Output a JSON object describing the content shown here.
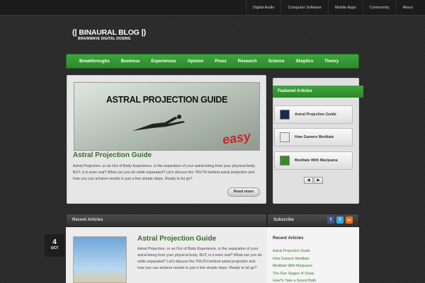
{
  "topnav": [
    "Digital Audio",
    "Computer Software",
    "Mobile Apps",
    "Community",
    "About"
  ],
  "logo": {
    "title": "BINAURAL BLOG",
    "subtitle": "BRAINWAVE DIGITAL DOSING"
  },
  "mainnav": [
    "Breakthroughs",
    "Business",
    "Experiences",
    "Opinion",
    "Press",
    "Research",
    "Science",
    "Skeptics",
    "Theory"
  ],
  "feature": {
    "image_title": "ASTRAL PROJECTION GUIDE",
    "image_tag": "easy",
    "title": "Astral Projection Guide",
    "excerpt": "Astral Projection, or an Out of Body Experience, is the separation of your astral being from your physical body. BUT, is it even real? What can you do while separated? Let's discuss the TRUTH behind astral projection and how you can achieve results in just a few simple steps. Ready to let go?",
    "readmore": "Read more"
  },
  "featured_articles": {
    "heading": "Featured Articles",
    "items": [
      "Astral Projection Guide",
      "How Gamers Meditate",
      "Meditate With Marijuana"
    ],
    "prev": "◀",
    "next": "▶"
  },
  "recent": {
    "heading": "Recent Articles",
    "date_day": "4",
    "date_month": "OCT",
    "title": "Astral Projection Guide",
    "excerpt": "Astral Projection, or an Out of Body Experience, is the separation of your astral being from your physical body. BUT, is it even real? What can you do while separated? Let's discuss the TRUTH behind astral projection and how you can achieve results in just a few simple steps. Ready to let go?"
  },
  "sidebar": {
    "subscribe": "Subscribe",
    "social": [
      "f",
      "t",
      "rss"
    ],
    "recent_heading": "Recent Articles",
    "recent_items": [
      "Astral Projection Guide",
      "How Gamers Meditate",
      "Meditate With Marijuana",
      "The Five Stages of Sleep",
      "HowTo Take a Sound Bath"
    ]
  },
  "colors": {
    "accent": "#2f962d",
    "link": "#3a6b30"
  }
}
